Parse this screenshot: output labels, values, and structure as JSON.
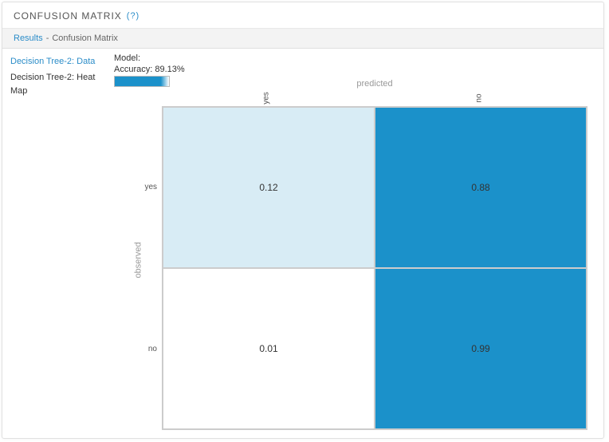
{
  "header": {
    "title": "CONFUSION MATRIX",
    "help": "(?)"
  },
  "breadcrumb": {
    "root": "Results",
    "sep": "-",
    "current": "Confusion Matrix"
  },
  "sidebar": {
    "items": [
      {
        "label": "Decision Tree-2: Data"
      },
      {
        "label": "Decision Tree-2: Heat Map"
      }
    ],
    "active_index": 0
  },
  "model_info": {
    "label": "Model:",
    "accuracy_label": "Accuracy: 89.13%"
  },
  "axes": {
    "predicted": "predicted",
    "observed": "observed",
    "cols": [
      "yes",
      "no"
    ],
    "rows": [
      "yes",
      "no"
    ]
  },
  "cells": {
    "r0c0": "0.12",
    "r0c1": "0.88",
    "r1c0": "0.01",
    "r1c1": "0.99"
  },
  "colors": {
    "low": "#ffffff",
    "light": "#d8ecf5",
    "high": "#1b91ca"
  },
  "chart_data": {
    "type": "heatmap",
    "title": "Confusion Matrix",
    "xlabel": "predicted",
    "ylabel": "observed",
    "categories_x": [
      "yes",
      "no"
    ],
    "categories_y": [
      "yes",
      "no"
    ],
    "values": [
      [
        0.12,
        0.88
      ],
      [
        0.01,
        0.99
      ]
    ],
    "model_accuracy": 0.8913,
    "color_scale": {
      "min_color": "#ffffff",
      "max_color": "#1b91ca"
    }
  }
}
